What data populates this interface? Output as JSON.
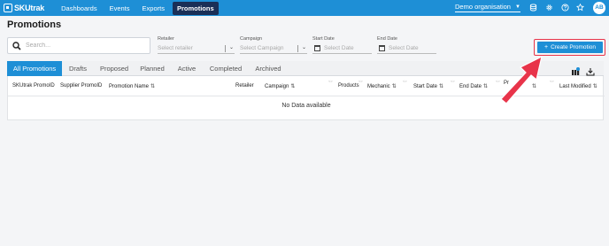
{
  "app": {
    "logo_text": "SKUtrak",
    "nav": [
      "Dashboards",
      "Events",
      "Exports",
      "Promotions"
    ],
    "active_nav": "Promotions",
    "organisation": "Demo organisation",
    "avatar_initials": "AB",
    "colors": {
      "brand": "#1e8fd6",
      "active_nav_bg": "#1a2f57",
      "highlight": "#e8344a"
    }
  },
  "page": {
    "title": "Promotions"
  },
  "filters": {
    "search_placeholder": "Search...",
    "retailer": {
      "label": "Retailer",
      "placeholder": "Select retailer"
    },
    "campaign": {
      "label": "Campaign",
      "placeholder": "Select Campaign"
    },
    "start_date": {
      "label": "Start Date",
      "placeholder": "Select Date"
    },
    "end_date": {
      "label": "End Date",
      "placeholder": "Select Date"
    }
  },
  "create_button": {
    "label": "Create Promotion",
    "icon": "plus-icon"
  },
  "tabs": [
    "All Promotions",
    "Drafts",
    "Proposed",
    "Planned",
    "Active",
    "Completed",
    "Archived"
  ],
  "active_tab": "All Promotions",
  "table": {
    "columns": [
      "SKUtrak PromoID",
      "Supplier PromoID",
      "Promotion Name",
      "Retailer",
      "Campaign",
      "Products",
      "Mechanic",
      "Start Date",
      "End Date",
      "Pr",
      "Last Modified"
    ],
    "empty_text": "No Data available"
  },
  "icons": [
    "database-icon",
    "gear-icon",
    "help-icon",
    "star-icon",
    "column-settings-icon",
    "download-icon"
  ]
}
